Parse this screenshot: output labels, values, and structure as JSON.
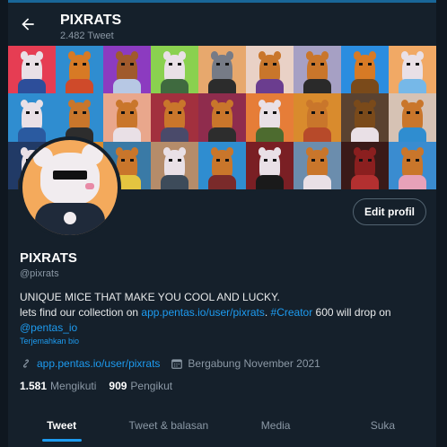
{
  "header": {
    "title": "PIXRATS",
    "subtitle": "2.482 Tweet"
  },
  "banner": {
    "tiles": [
      {
        "bg": "#e63d53",
        "fur": "#e9e0e6",
        "shirt": "#2d4e9a"
      },
      {
        "bg": "#2f8dd0",
        "fur": "#d77a25",
        "shirt": "#cf4a2a"
      },
      {
        "bg": "#8c3bc0",
        "fur": "#a05a2c",
        "shirt": "#b7c8e4"
      },
      {
        "bg": "#8ad14f",
        "fur": "#e9e0e6",
        "shirt": "#3f6a3f"
      },
      {
        "bg": "#e7a86d",
        "fur": "#767b86",
        "shirt": "#2c2c2c"
      },
      {
        "bg": "#e9d1c6",
        "fur": "#c9762b",
        "shirt": "#6b3d8f"
      },
      {
        "bg": "#a6a0c4",
        "fur": "#c9762b",
        "shirt": "#2a2a2a"
      },
      {
        "bg": "#2b8de0",
        "fur": "#d77a25",
        "shirt": "#7a4a1a"
      },
      {
        "bg": "#f1a965",
        "fur": "#e9e0e6",
        "shirt": "#76b8e8"
      },
      {
        "bg": "#2f8dd0",
        "fur": "#e9e0e6",
        "shirt": "#2a5aa0"
      },
      {
        "bg": "#2f8dd0",
        "fur": "#c9762b",
        "shirt": "#2d2d2d"
      },
      {
        "bg": "#e9a78c",
        "fur": "#c9762b",
        "shirt": "#e9e0e6"
      },
      {
        "bg": "#a2303e",
        "fur": "#c9762b",
        "shirt": "#4a4a6a"
      },
      {
        "bg": "#8f2c4d",
        "fur": "#c9762b",
        "shirt": "#2d2d2d"
      },
      {
        "bg": "#e67d38",
        "fur": "#e9e0e6",
        "shirt": "#4d6b2f"
      },
      {
        "bg": "#d98b2d",
        "fur": "#c9762b",
        "shirt": "#b74a2a"
      },
      {
        "bg": "#5a4230",
        "fur": "#7a4a1a",
        "shirt": "#e9e0e6"
      },
      {
        "bg": "#d6c2b4",
        "fur": "#c9762b",
        "shirt": "#2f8dd0"
      },
      {
        "bg": "#213a66",
        "fur": "#e9e0e6",
        "shirt": "#2a2a2a"
      },
      {
        "bg": "#d98b2d",
        "fur": "#c9762b",
        "shirt": "#3f7a3a"
      },
      {
        "bg": "#3a7aa6",
        "fur": "#c9762b",
        "shirt": "#e4c540"
      },
      {
        "bg": "#b58c6a",
        "fur": "#e9e0e6",
        "shirt": "#3d4b5a"
      },
      {
        "bg": "#2f8dd0",
        "fur": "#c9762b",
        "shirt": "#7a2a2a"
      },
      {
        "bg": "#7a1f24",
        "fur": "#e9e0e6",
        "shirt": "#1a1a1a"
      },
      {
        "bg": "#6b8dad",
        "fur": "#c9762b",
        "shirt": "#e9e0e6"
      },
      {
        "bg": "#3a1a18",
        "fur": "#8b1f1f",
        "shirt": "#b33030"
      },
      {
        "bg": "#3a8cd0",
        "fur": "#c9762b",
        "shirt": "#e7a1b9"
      }
    ]
  },
  "profile": {
    "name": "PIXRATS",
    "handle": "@pixrats",
    "edit_button": "Edit profil",
    "bio": {
      "line1": "UNIQUE MICE THAT MAKE YOU COOL AND LUCKY.",
      "line2_prefix": "lets find our collection on ",
      "line2_link": "app.pentas.io/user/pixrats",
      "line2_mid": ". ",
      "line2_hashtag": "#Creator",
      "line2_suffix": " 600 will drop on",
      "line3_mention": "@pentas_io"
    },
    "translate_label": "Terjemahkan bio",
    "website": "app.pentas.io/user/pixrats",
    "joined": "Bergabung November 2021",
    "following_count": "1.581",
    "following_label": "Mengikuti",
    "followers_count": "909",
    "followers_label": "Pengikut"
  },
  "tabs": [
    {
      "label": "Tweet",
      "active": true
    },
    {
      "label": "Tweet & balasan",
      "active": false
    },
    {
      "label": "Media",
      "active": false
    },
    {
      "label": "Suka",
      "active": false
    }
  ],
  "colors": {
    "background": "#15202b",
    "accent": "#1d9bf0",
    "muted_text": "#8b98a5"
  }
}
